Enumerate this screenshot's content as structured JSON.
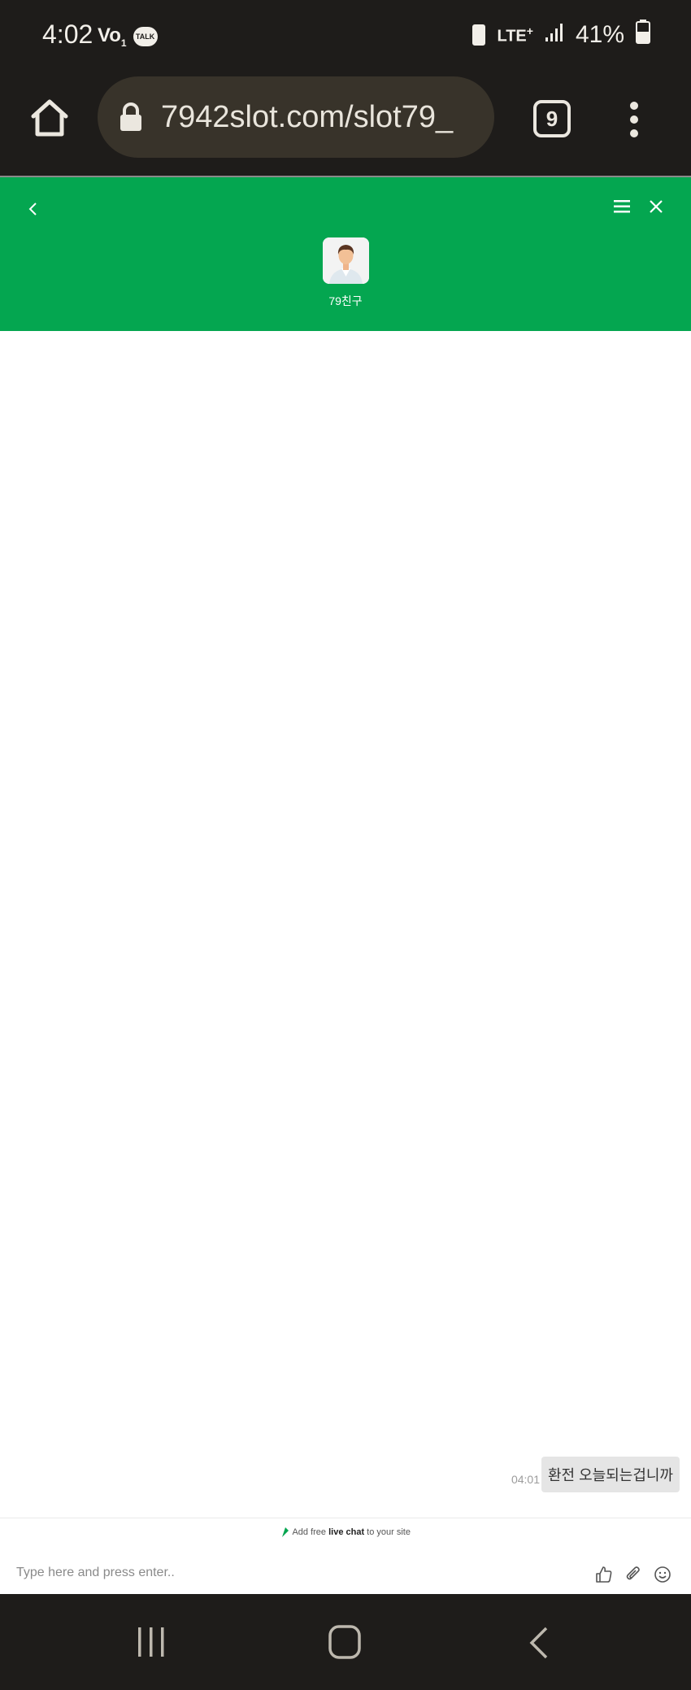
{
  "status": {
    "time": "4:02",
    "network": "LTE",
    "network_plus": "+",
    "battery": "41%",
    "talk_label": "TALK",
    "vol_label": "Vo",
    "sim_num": "1"
  },
  "browser": {
    "url": "7942slot.com/slot79_",
    "tab_count": "9"
  },
  "chat": {
    "agent_name": "79친구",
    "messages": [
      {
        "time": "04:01",
        "text": "환전 오늘되는겁니까",
        "from": "visitor"
      }
    ],
    "powered_prefix": "Add free ",
    "powered_bold": "live chat",
    "powered_suffix": " to your site",
    "input_placeholder": "Type here and press enter.."
  },
  "colors": {
    "header_green": "#04a650",
    "system_bar": "#1e1c1a",
    "url_pill": "#38332a"
  },
  "icons": {
    "browser": [
      "home-icon",
      "lock-icon",
      "more-vert-icon"
    ],
    "chat_header": [
      "chevron-left-icon",
      "hamburger-menu-icon",
      "close-icon"
    ],
    "composer": [
      "thumbs-up-icon",
      "paperclip-icon",
      "smiley-icon"
    ],
    "nav": [
      "recents-icon",
      "home-nav-icon",
      "back-nav-icon"
    ]
  }
}
